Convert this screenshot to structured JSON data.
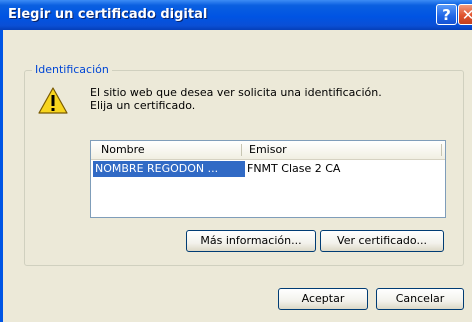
{
  "window": {
    "title": "Elegir un certificado digital",
    "help_symbol": "?",
    "close_symbol": "✕"
  },
  "group": {
    "legend": "Identificación",
    "icon": "warning-icon",
    "message_line1": "El sitio web que desea ver solicita una identificación.",
    "message_line2": "Elija un certificado."
  },
  "list": {
    "columns": [
      "Nombre",
      "Emisor"
    ],
    "rows": [
      {
        "name": "NOMBRE REGODON ...",
        "issuer": "FNMT Clase 2 CA",
        "selected": true
      }
    ]
  },
  "buttons": {
    "more_info": "Más información...",
    "view_cert": "Ver certificado...",
    "accept": "Aceptar",
    "cancel": "Cancelar"
  },
  "colors": {
    "titlebar": "#0054e3",
    "dialog_bg": "#ece9d8",
    "legend_text": "#0046d5",
    "selection": "#316ac5",
    "close_button": "#e0522d"
  }
}
